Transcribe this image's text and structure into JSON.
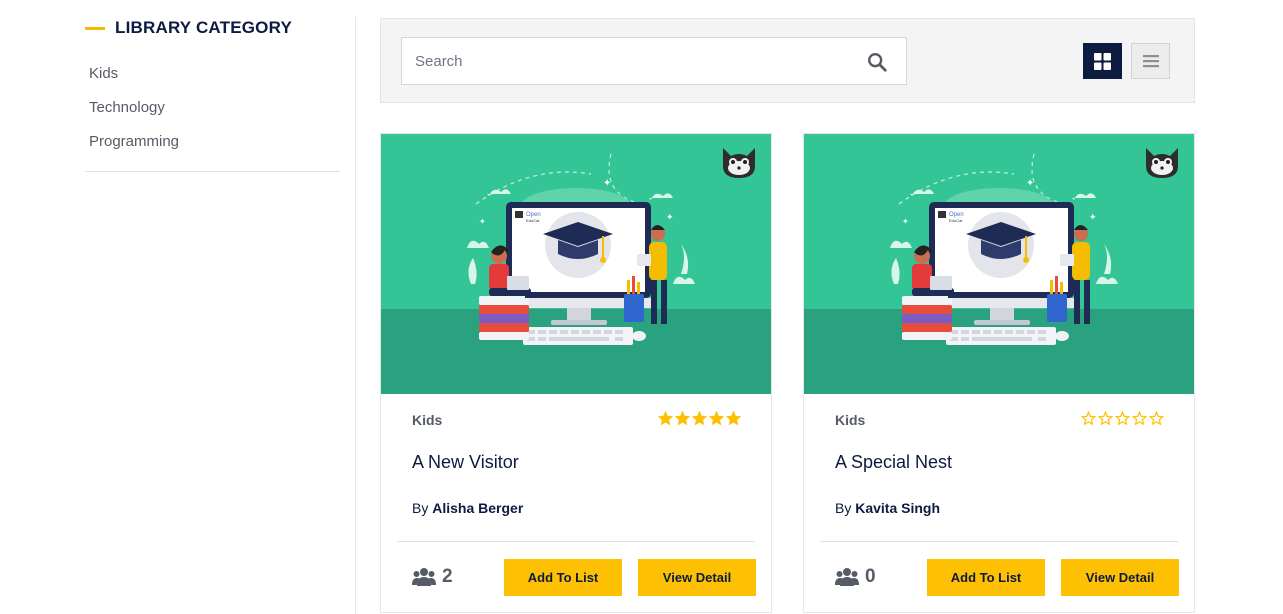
{
  "sidebar": {
    "title": "LIBRARY CATEGORY",
    "items": [
      {
        "label": "Kids"
      },
      {
        "label": "Technology"
      },
      {
        "label": "Programming"
      }
    ]
  },
  "search": {
    "placeholder": "Search",
    "value": ""
  },
  "view_modes": {
    "active": "grid",
    "options": [
      "grid",
      "list"
    ]
  },
  "colors": {
    "navy": "#0c1b3f",
    "accent_yellow": "#fec002",
    "thumb_green": "#33c596",
    "thumb_green_dark": "#2aa280"
  },
  "cards": [
    {
      "category": "Kids",
      "rating": 5,
      "title": "A New Visitor",
      "by_label": "By",
      "author": "Alisha Berger",
      "members": "2",
      "add_label": "Add To List",
      "view_label": "View Detail",
      "logo_text_1": "Open",
      "logo_text_2": "EduCat"
    },
    {
      "category": "Kids",
      "rating": 0,
      "title": "A Special Nest",
      "by_label": "By",
      "author": "Kavita Singh",
      "members": "0",
      "add_label": "Add To List",
      "view_label": "View Detail",
      "logo_text_1": "Open",
      "logo_text_2": "EduCat"
    }
  ]
}
